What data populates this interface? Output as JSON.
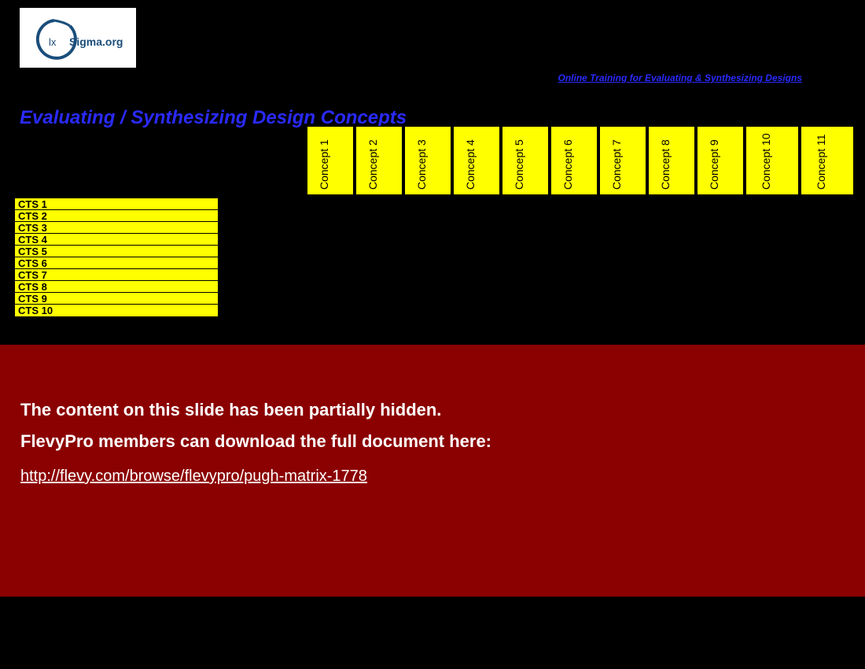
{
  "logo": {
    "text_left": "lx",
    "text_right": "Sigma.org"
  },
  "top_link": "Online Training for Evaluating & Synthesizing Designs",
  "title": "Evaluating / Synthesizing Design Concepts",
  "concepts": [
    "Concept 1",
    "Concept 2",
    "Concept 3",
    "Concept 4",
    "Concept 5",
    "Concept 6",
    "Concept 7",
    "Concept 8",
    "Concept 9",
    "Concept 10",
    "Concept 11"
  ],
  "cts": [
    "CTS 1",
    "CTS 2",
    "CTS 3",
    "CTS 4",
    "CTS 5",
    "CTS 6",
    "CTS 7",
    "CTS 8",
    "CTS 9",
    "CTS 10"
  ],
  "overlay": {
    "line1": "The content on this slide has been partially hidden.",
    "line2": "FlevyPro members can download the full document here:",
    "link": "http://flevy.com/browse/flevypro/pugh-matrix-1778"
  }
}
